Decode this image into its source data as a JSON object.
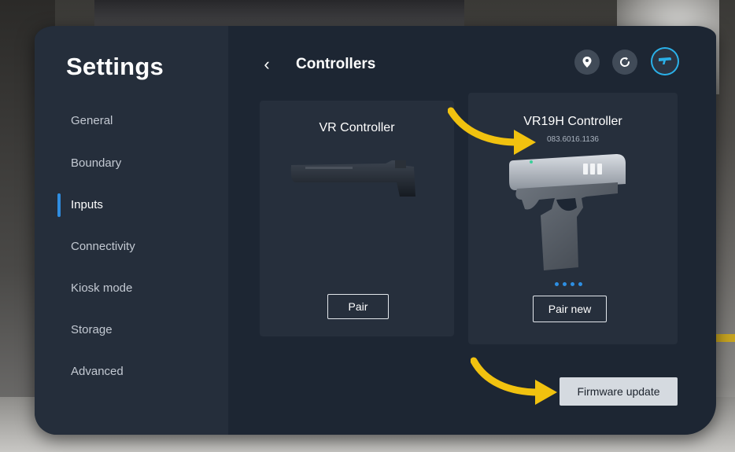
{
  "sidebar": {
    "title": "Settings",
    "items": [
      {
        "label": "General"
      },
      {
        "label": "Boundary"
      },
      {
        "label": "Inputs",
        "active": true
      },
      {
        "label": "Connectivity"
      },
      {
        "label": "Kiosk mode"
      },
      {
        "label": "Storage"
      },
      {
        "label": "Advanced"
      }
    ]
  },
  "header": {
    "back_icon": "‹",
    "title": "Controllers",
    "icons": [
      "location-pin-icon",
      "refresh-icon",
      "controller-icon"
    ]
  },
  "cards": [
    {
      "name": "VR Controller",
      "button_label": "Pair",
      "image": "vr-controller-image"
    },
    {
      "name": "VR19H Controller",
      "serial": "083.6016.1136",
      "button_label": "Pair new",
      "image": "pistol-controller-image",
      "status_dots": 4
    }
  ],
  "firmware_button": "Firmware update",
  "colors": {
    "panel_bg": "#1d2633",
    "sidebar_bg": "#252e3b",
    "card_bg": "#262f3c",
    "accent_blue": "#2e8fe3",
    "arrow_yellow": "#f1c20f",
    "firmware_btn_bg": "#d5dae0"
  }
}
